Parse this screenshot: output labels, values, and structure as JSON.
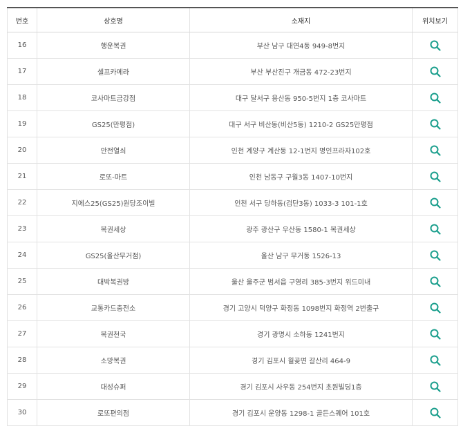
{
  "table": {
    "headers": {
      "number": "번호",
      "name": "상호명",
      "address": "소재지",
      "location": "위치보기"
    },
    "rows": [
      {
        "number": "16",
        "name": "행운복권",
        "address": "부산 남구 대연4동 949-8번지"
      },
      {
        "number": "17",
        "name": "셀프카메라",
        "address": "부산 부산진구 개금동 472-23번지"
      },
      {
        "number": "18",
        "name": "코사마트금강점",
        "address": "대구 달서구 용산동 950-5번지 1층 코사마트"
      },
      {
        "number": "19",
        "name": "GS25(만평점)",
        "address": "대구 서구 비산동(비산5동) 1210-2 GS25만평점"
      },
      {
        "number": "20",
        "name": "안전열쇠",
        "address": "인천 계양구 계산동 12-1번지 명인프라자102호"
      },
      {
        "number": "21",
        "name": "로또-마트",
        "address": "인천 남동구 구월3동 1407-10번지"
      },
      {
        "number": "22",
        "name": "지에스25(GS25)원당조이빌",
        "address": "인천 서구 당하동(검단3동) 1033-3 101-1호"
      },
      {
        "number": "23",
        "name": "복권세상",
        "address": "광주 광산구 우산동 1580-1 복권세상"
      },
      {
        "number": "24",
        "name": "GS25(울산무거점)",
        "address": "울산 남구 무거동 1526-13"
      },
      {
        "number": "25",
        "name": "대박복권방",
        "address": "울산 울주군 범서읍 구영리 385-3번지 위드미내"
      },
      {
        "number": "26",
        "name": "교통카드충전소",
        "address": "경기 고양시 덕양구 화정동 1098번지 화정역 2번출구"
      },
      {
        "number": "27",
        "name": "복권천국",
        "address": "경기 광명시 소하동 1241번지"
      },
      {
        "number": "28",
        "name": "소망복권",
        "address": "경기 김포시 월곶면 갈산리 464-9"
      },
      {
        "number": "29",
        "name": "대성슈퍼",
        "address": "경기 김포시 사우동 254번지 초원빌딩1층"
      },
      {
        "number": "30",
        "name": "로또편의점",
        "address": "경기 김포시 운양동 1298-1 골든스퀘어 101호"
      }
    ]
  },
  "icons": {
    "location": "search-icon"
  },
  "colors": {
    "header_border": "#555555",
    "accent": "#1a9e8c",
    "text": "#555555"
  }
}
